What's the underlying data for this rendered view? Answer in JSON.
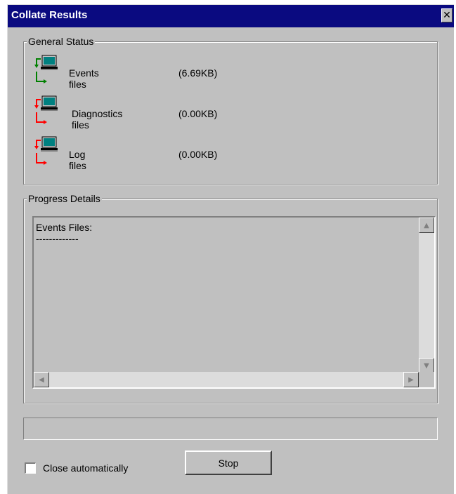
{
  "window": {
    "title": "Collate Results",
    "close_glyph": "✕"
  },
  "general_status": {
    "label": "General Status",
    "rows": [
      {
        "label": "Events files",
        "size": "(6.69KB)",
        "icon": "collate-transfer-icon",
        "state_color": "#008000"
      },
      {
        "label": "Diagnostics files",
        "size": "(0.00KB)",
        "icon": "collate-transfer-icon",
        "state_color": "#ff0000"
      },
      {
        "label": "Log files",
        "size": "(0.00KB)",
        "icon": "collate-transfer-icon",
        "state_color": "#ff0000"
      }
    ]
  },
  "progress_details": {
    "label": "Progress Details",
    "text": "Events Files:\n-------------"
  },
  "progress_bar": {
    "fraction": 0
  },
  "close_automatically": {
    "label": "Close automatically",
    "checked": false
  },
  "buttons": {
    "stop": "Stop"
  },
  "colors": {
    "title_bar": "#0a0a80",
    "dialog_bg": "#c0c0c0",
    "success": "#008000",
    "error": "#ff0000"
  }
}
